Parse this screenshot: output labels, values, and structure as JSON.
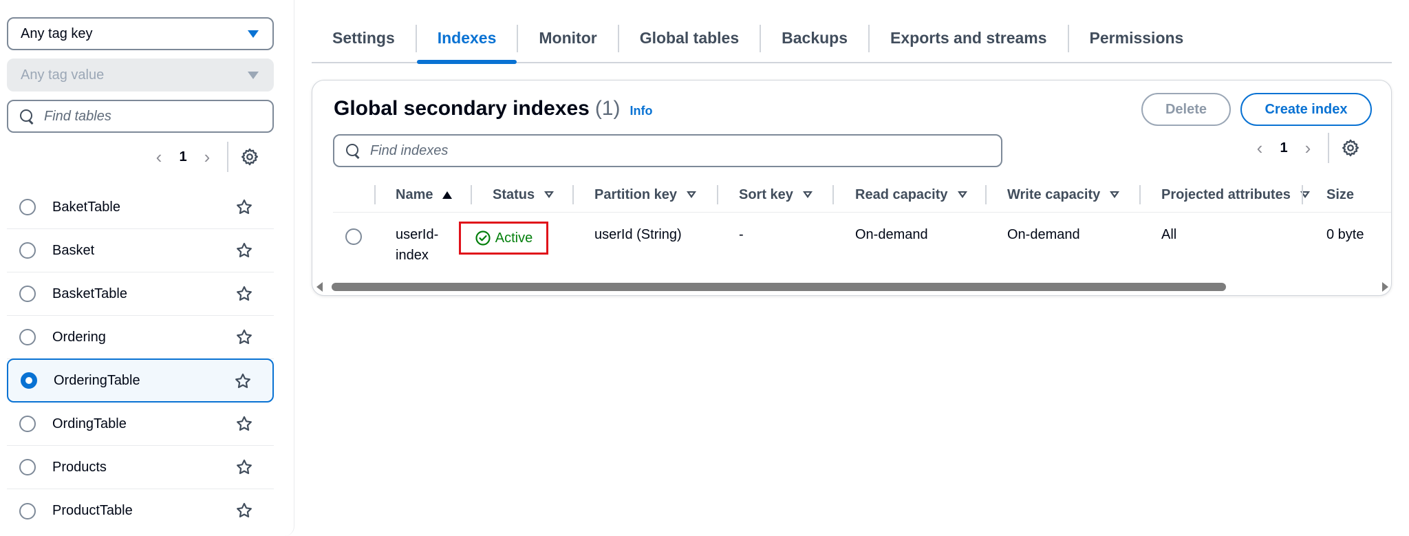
{
  "sidebar": {
    "tag_key_select": "Any tag key",
    "tag_value_select": "Any tag value",
    "search_placeholder": "Find tables",
    "page": "1",
    "tables": [
      {
        "label": "BaketTable",
        "selected": false
      },
      {
        "label": "Basket",
        "selected": false
      },
      {
        "label": "BasketTable",
        "selected": false
      },
      {
        "label": "Ordering",
        "selected": false
      },
      {
        "label": "OrderingTable",
        "selected": true
      },
      {
        "label": "OrdingTable",
        "selected": false
      },
      {
        "label": "Products",
        "selected": false
      },
      {
        "label": "ProductTable",
        "selected": false
      }
    ]
  },
  "tabs": [
    {
      "label": "Settings",
      "active": false
    },
    {
      "label": "Indexes",
      "active": true
    },
    {
      "label": "Monitor",
      "active": false
    },
    {
      "label": "Global tables",
      "active": false
    },
    {
      "label": "Backups",
      "active": false
    },
    {
      "label": "Exports and streams",
      "active": false
    },
    {
      "label": "Permissions",
      "active": false
    }
  ],
  "indexes": {
    "title": "Global secondary indexes",
    "count": "(1)",
    "info_link": "Info",
    "delete_label": "Delete",
    "create_label": "Create index",
    "search_placeholder": "Find indexes",
    "page": "1",
    "columns": [
      "Name",
      "Status",
      "Partition key",
      "Sort key",
      "Read capacity",
      "Write capacity",
      "Projected attributes",
      "Size"
    ],
    "rows": [
      {
        "name_line1": "userId-",
        "name_line2": "index",
        "status": "Active",
        "partition_key": "userId (String)",
        "sort_key": "-",
        "read_capacity": "On-demand",
        "write_capacity": "On-demand",
        "projected_attributes": "All",
        "size": "0 byte"
      }
    ]
  },
  "colors": {
    "accent": "#0972d3",
    "success": "#037f0c",
    "highlight": "#e0111a",
    "text": "#000716",
    "muted": "#414d5c"
  }
}
